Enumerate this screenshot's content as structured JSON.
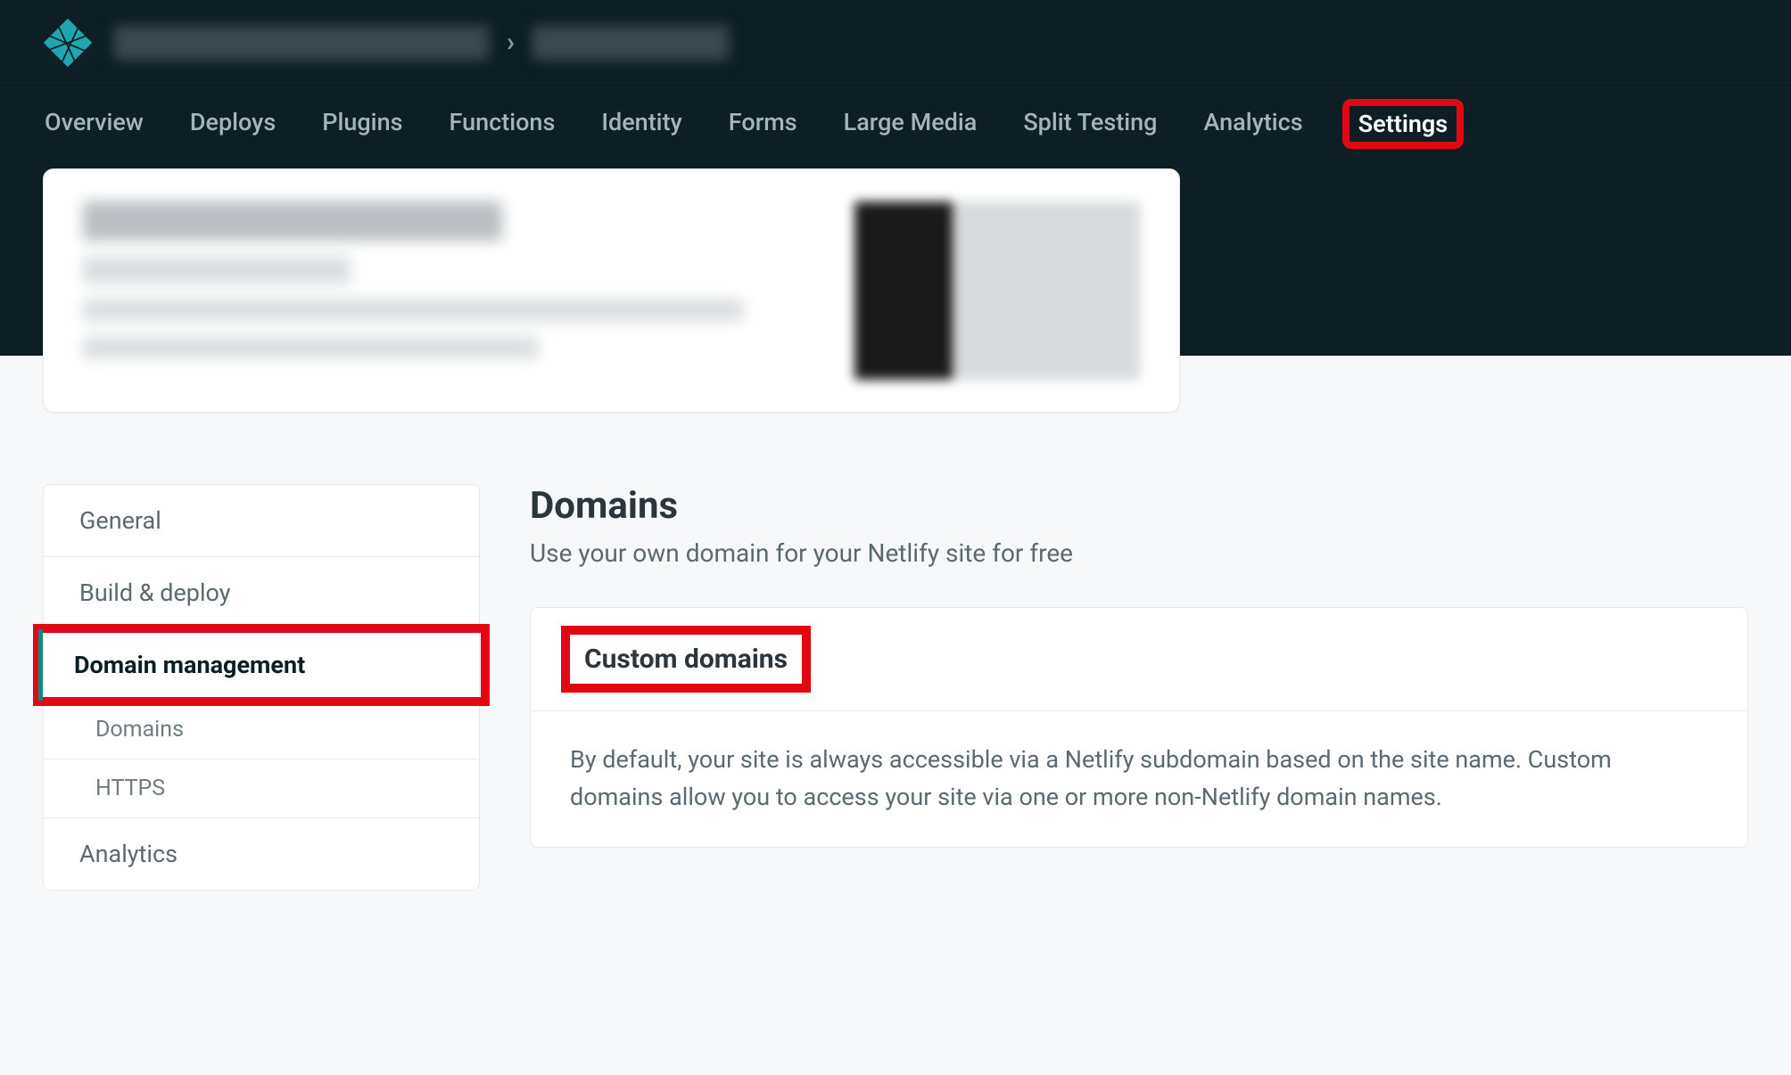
{
  "nav": {
    "tabs": [
      {
        "label": "Overview",
        "active": false
      },
      {
        "label": "Deploys",
        "active": false
      },
      {
        "label": "Plugins",
        "active": false
      },
      {
        "label": "Functions",
        "active": false
      },
      {
        "label": "Identity",
        "active": false
      },
      {
        "label": "Forms",
        "active": false
      },
      {
        "label": "Large Media",
        "active": false
      },
      {
        "label": "Split Testing",
        "active": false
      },
      {
        "label": "Analytics",
        "active": false
      },
      {
        "label": "Settings",
        "active": true
      }
    ],
    "highlighted": "Settings"
  },
  "sidebar": {
    "items": [
      {
        "label": "General",
        "active": false,
        "sub": []
      },
      {
        "label": "Build & deploy",
        "active": false,
        "sub": []
      },
      {
        "label": "Domain management",
        "active": true,
        "highlighted": true,
        "sub": [
          {
            "label": "Domains"
          },
          {
            "label": "HTTPS"
          }
        ]
      },
      {
        "label": "Analytics",
        "active": false,
        "sub": []
      }
    ]
  },
  "main": {
    "heading": "Domains",
    "subheading": "Use your own domain for your Netlify site for free",
    "panel": {
      "title": "Custom domains",
      "highlighted": true,
      "body": "By default, your site is always accessible via a Netlify subdomain based on the site name. Custom domains allow you to access your site via one or more non-Netlify domain names."
    }
  }
}
